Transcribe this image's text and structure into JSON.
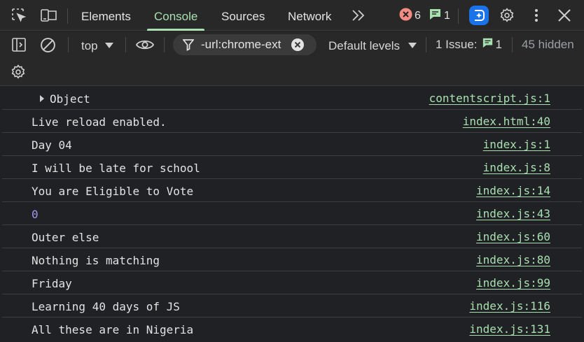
{
  "toolbar": {
    "tabs": [
      "Elements",
      "Console",
      "Sources",
      "Network"
    ],
    "errors_count": "6",
    "messages_count": "1"
  },
  "filterbar": {
    "context": "top",
    "filter_value": "-url:chrome-ext",
    "levels": "Default levels",
    "issues_label": "1 Issue:",
    "issues_count": "1",
    "hidden": "45 hidden"
  },
  "console": {
    "rows": [
      {
        "message": "Object",
        "source": "contentscript.js:1"
      },
      {
        "message": "Live reload enabled.",
        "source": "index.html:40"
      },
      {
        "message": "Day 04",
        "source": "index.js:1"
      },
      {
        "message": "I will be late for school",
        "source": "index.js:8"
      },
      {
        "message": "You are Eligible to Vote",
        "source": "index.js:14"
      },
      {
        "message": "0",
        "source": "index.js:43"
      },
      {
        "message": "Outer else",
        "source": "index.js:60"
      },
      {
        "message": "Nothing is matching",
        "source": "index.js:80"
      },
      {
        "message": "Friday",
        "source": "index.js:99"
      },
      {
        "message": "Learning 40 days of JS",
        "source": "index.js:116"
      },
      {
        "message": "All these are in Nigeria",
        "source": "index.js:131"
      }
    ]
  },
  "colors": {
    "accent": "#a8e0b0",
    "error": "#f28b82",
    "number": "#9e98f5",
    "background": "#202124"
  }
}
